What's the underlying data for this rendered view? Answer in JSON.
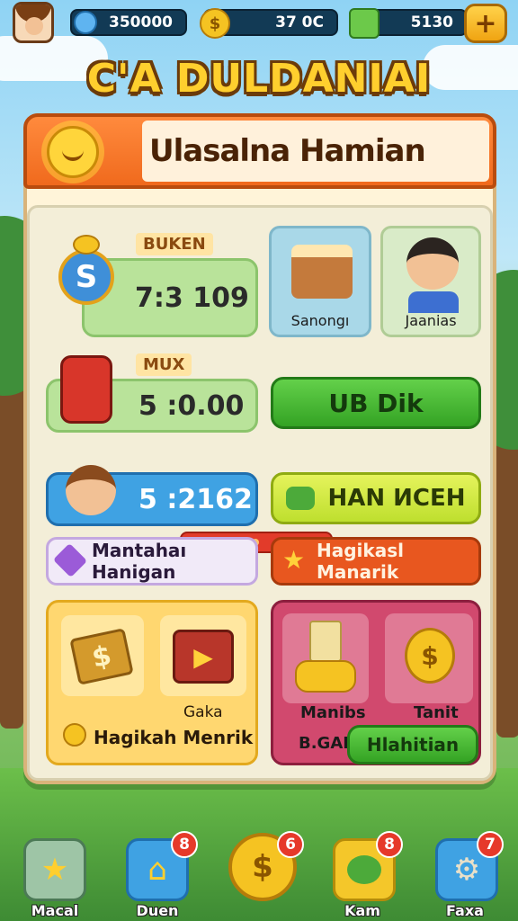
{
  "topbar": {
    "gems": "350000",
    "coins": "37 0C",
    "cash": "5130",
    "coin_symbol": "$"
  },
  "game_title": "C'A DULDANIAI",
  "panel": {
    "header_title": "Ulasalna Hamian",
    "row1": {
      "tag": "BUKEN",
      "timer": "7:3 109"
    },
    "card_snack": "Sanongı",
    "card_character": "Jaanias",
    "row2": {
      "tag": "MUX",
      "timer": "5 :0.00",
      "button": "UB Dik"
    },
    "row3": {
      "timer": "5 :2162",
      "button": "HAN ИCEH"
    },
    "pill_left": "Mantahaı Hanigan",
    "pill_right": "Hagikasl Manarik",
    "box_left": {
      "label_small": "Gaka",
      "label": "Hagikah Menrik"
    },
    "box_right": {
      "label_a": "Manibs",
      "label_b": "Tanit",
      "label_c": "B.GAI",
      "button": "Hlahitian"
    }
  },
  "nav": [
    {
      "label": "Macal",
      "icon": "star-icon",
      "badge": ""
    },
    {
      "label": "Duen",
      "icon": "house-icon",
      "badge": "8"
    },
    {
      "label": "",
      "icon": "coin-icon",
      "badge": "6"
    },
    {
      "label": "Kam",
      "icon": "chat-icon",
      "badge": "8"
    },
    {
      "label": "Faxa",
      "icon": "gear-icon",
      "badge": "7"
    }
  ]
}
